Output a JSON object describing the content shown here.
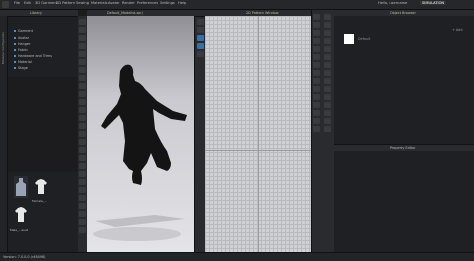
{
  "menubar": {
    "items": [
      "File",
      "Edit",
      "3D Garment",
      "2D Pattern",
      "Sewing",
      "Materials",
      "Avatar",
      "Render",
      "Preferences",
      "Settings",
      "Help"
    ],
    "username": "Hello, username",
    "brand": "SIMULATION"
  },
  "library": {
    "title": "Library",
    "side_label": "Modular Configurator",
    "tree": {
      "root": "Garment",
      "items": [
        "Avatar",
        "Hanger",
        "Fabric",
        "Hardware and Trims",
        "Material",
        "Stage"
      ]
    },
    "thumbnails": [
      {
        "label": "Female_..."
      },
      {
        "label": ""
      },
      {
        "label": "Male_...avat"
      }
    ]
  },
  "viewport3d": {
    "title": "Default_Modelist.zprj"
  },
  "viewport2d": {
    "title": "2D Pattern Window"
  },
  "object_browser": {
    "title": "Object Browser",
    "add_label": "+ Add",
    "item_label": "Default"
  },
  "property_editor": {
    "title": "Property Editor"
  },
  "statusbar": {
    "text": "Version: 7.0.0.0 (r48498)"
  },
  "colors": {
    "accent": "#4a90d9",
    "panel": "#1f2023",
    "toolbar": "#2a2b2e"
  }
}
